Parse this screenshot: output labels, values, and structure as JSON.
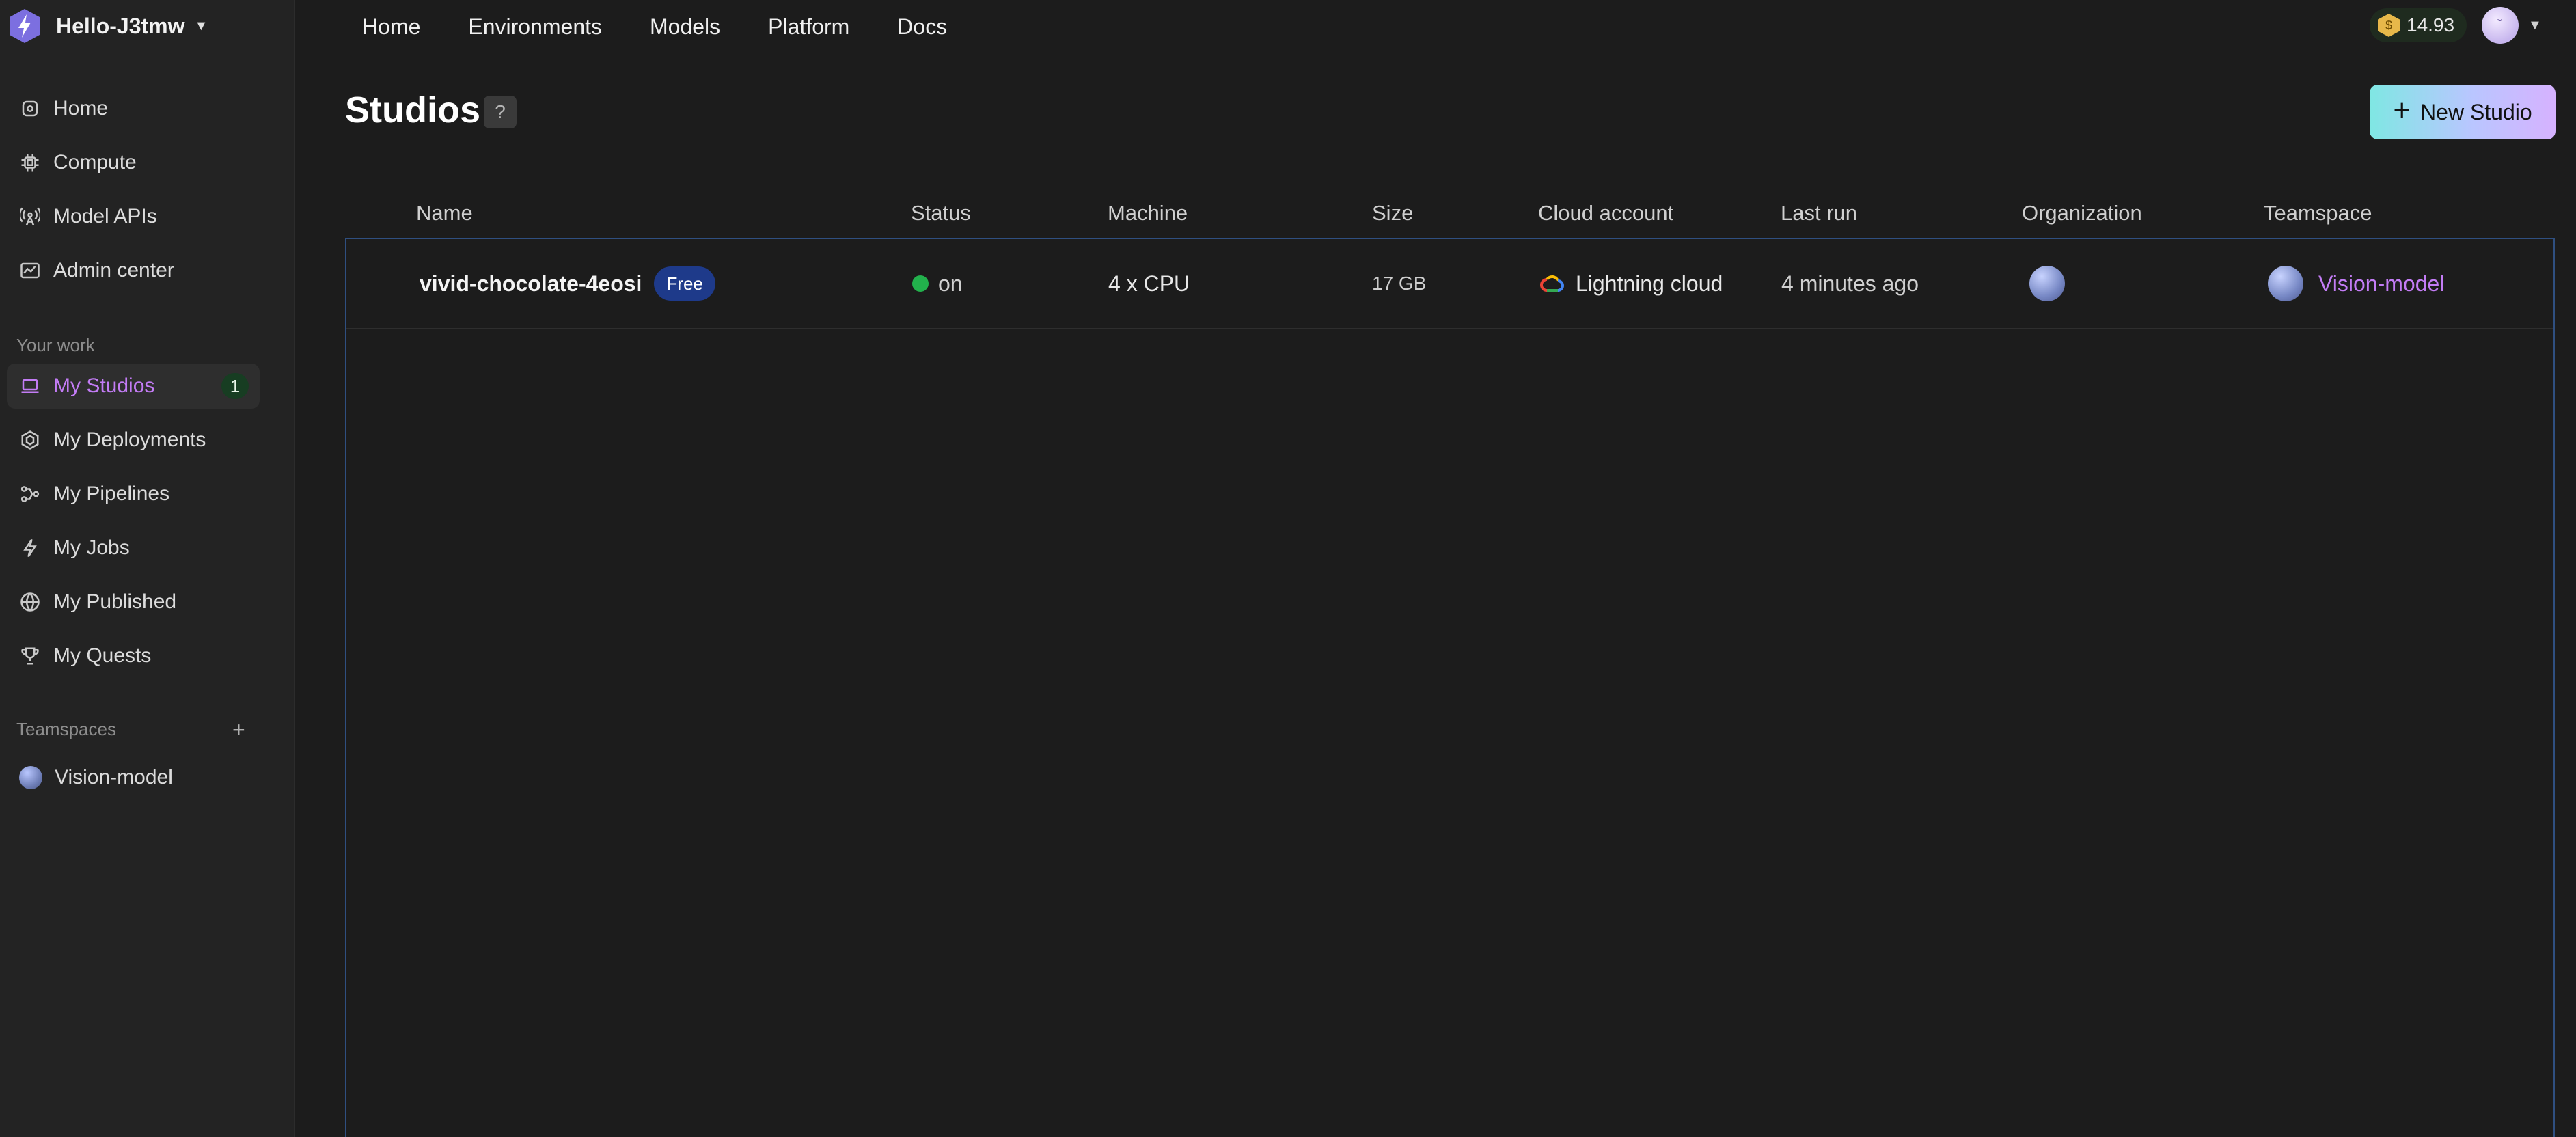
{
  "workspace": {
    "name": "Hello-J3tmw"
  },
  "topnav": [
    "Home",
    "Environments",
    "Models",
    "Platform",
    "Docs"
  ],
  "credits": {
    "amount": "14.93",
    "coin_symbol": "$"
  },
  "sidebar": {
    "main_items": [
      {
        "label": "Home",
        "icon": "home-icon"
      },
      {
        "label": "Compute",
        "icon": "chip-icon"
      },
      {
        "label": "Model APIs",
        "icon": "antenna-icon"
      },
      {
        "label": "Admin center",
        "icon": "chart-icon"
      }
    ],
    "your_work_label": "Your work",
    "work_items": [
      {
        "label": "My Studios",
        "icon": "laptop-icon",
        "active": true,
        "count": "1"
      },
      {
        "label": "My Deployments",
        "icon": "cube-icon"
      },
      {
        "label": "My Pipelines",
        "icon": "pipeline-icon"
      },
      {
        "label": "My Jobs",
        "icon": "bolt-icon"
      },
      {
        "label": "My Published",
        "icon": "globe-icon"
      },
      {
        "label": "My Quests",
        "icon": "trophy-icon"
      }
    ],
    "teamspaces_label": "Teamspaces",
    "add_symbol": "+",
    "teamspaces": [
      {
        "label": "Vision-model"
      }
    ]
  },
  "page": {
    "title": "Studios",
    "help_symbol": "?",
    "new_button_label": "New Studio",
    "new_button_symbol": "+"
  },
  "table": {
    "columns": [
      "Name",
      "Status",
      "Machine",
      "Size",
      "Cloud account",
      "Last run",
      "Organization",
      "Teamspace"
    ],
    "rows": [
      {
        "name": "vivid-chocolate-4eosi",
        "badge": "Free",
        "status": "on",
        "machine": "4 x CPU",
        "size": "17 GB",
        "cloud_account": "Lightning cloud",
        "last_run": "4 minutes ago",
        "teamspace": "Vision-model"
      }
    ]
  },
  "colors": {
    "accent": "#c37cf5",
    "status_on": "#22b14c",
    "badge": "#1e3a8a"
  }
}
